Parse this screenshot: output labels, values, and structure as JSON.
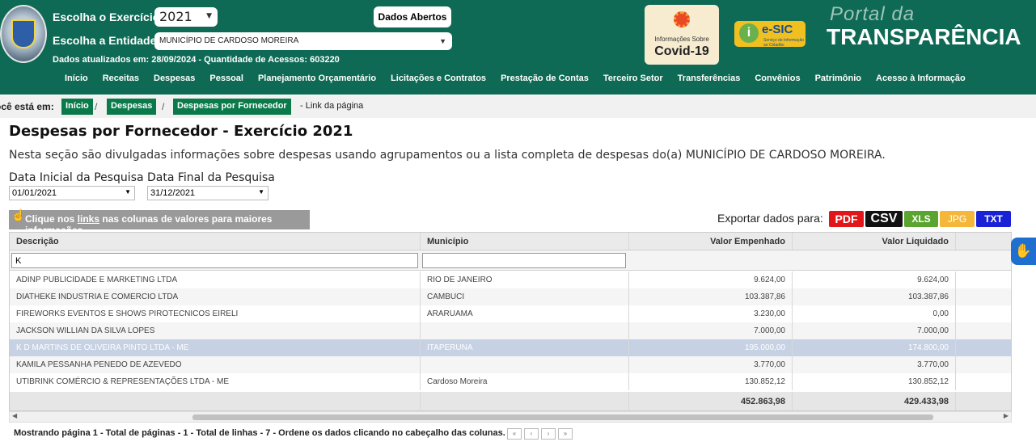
{
  "header": {
    "exercise_label": "Escolha o Exercício:",
    "exercise_value": "2021",
    "entity_label": "Escolha a Entidade:",
    "entity_value": "MUNICÍPIO DE CARDOSO MOREIRA",
    "open_data_button": "Dados Abertos",
    "updated_text": "Dados atualizados em: 28/09/2024 - Quantidade de Acessos: 603220",
    "covid_line1": "Informações Sobre",
    "covid_line2": "Covid-19",
    "esic_label": "e-SIC",
    "esic_sub": "Serviço de Informação ao Cidadão",
    "portal_line1": "Portal da",
    "portal_line2": "TRANSPARÊNCIA"
  },
  "nav": [
    "Início",
    "Receitas",
    "Despesas",
    "Pessoal",
    "Planejamento Orçamentário",
    "Licitações e Contratos",
    "Prestação de Contas",
    "Terceiro Setor",
    "Transferências",
    "Convênios",
    "Patrimônio",
    "Acesso à Informação"
  ],
  "breadcrumb": {
    "prefix": "ocê está em:",
    "items": [
      "Início",
      "Despesas",
      "Despesas por Fornecedor"
    ],
    "link": "- Link da página"
  },
  "page": {
    "title": "Despesas por Fornecedor - Exercício 2021",
    "description": "Nesta seção são divulgadas informações sobre despesas usando agrupamentos ou a lista completa de despesas do(a) MUNICÍPIO DE CARDOSO MOREIRA.",
    "start_label": "Data Inicial da Pesquisa",
    "start_value": "01/01/2021",
    "end_label": "Data Final da Pesquisa",
    "end_value": "31/12/2021",
    "hint_pre": "Clique nos ",
    "hint_link": "links",
    "hint_post": " nas colunas de valores para maiores informações",
    "export_label": "Exportar dados para:",
    "export_buttons": [
      "PDF",
      "CSV",
      "XLS",
      "JPG",
      "TXT"
    ],
    "export_colors": [
      "#e0161b",
      "#111111",
      "#5aa52f",
      "#f5b73a",
      "#1a22d8"
    ]
  },
  "table": {
    "headers": [
      "Descrição",
      "Município",
      "Valor Empenhado",
      "Valor Liquidado"
    ],
    "filter_descricao": "K",
    "filter_municipio": "",
    "rows": [
      [
        "ADINP PUBLICIDADE E MARKETING LTDA",
        "RIO DE JANEIRO",
        "9.624,00",
        "9.624,00"
      ],
      [
        "DIATHEKE INDUSTRIA E COMERCIO LTDA",
        "CAMBUCI",
        "103.387,86",
        "103.387,86"
      ],
      [
        "FIREWORKS EVENTOS E SHOWS PIROTECNICOS EIRELI",
        "ARARUAMA",
        "3.230,00",
        "0,00"
      ],
      [
        "JACKSON WILLIAN DA SILVA LOPES",
        "",
        "7.000,00",
        "7.000,00"
      ],
      [
        "K D MARTINS DE OLIVEIRA PINTO LTDA - ME",
        "ITAPERUNA",
        "195.000,00",
        "174.800,00"
      ],
      [
        "KAMILA PESSANHA PENEDO DE AZEVEDO",
        "",
        "3.770,00",
        "3.770,00"
      ],
      [
        "UTIBRINK COMÉRCIO & REPRESENTAÇÕES LTDA - ME",
        "Cardoso Moreira",
        "130.852,12",
        "130.852,12"
      ]
    ],
    "selected_row": 4,
    "total_empenhado": "452.863,98",
    "total_liquidado": "429.433,98"
  },
  "footer": {
    "text": "Mostrando página 1 - Total de páginas - 1 - Total de linhas - 7 - Ordene os dados clicando no cabeçalho das colunas.",
    "pager": [
      "«",
      "‹",
      "›",
      "»"
    ]
  }
}
